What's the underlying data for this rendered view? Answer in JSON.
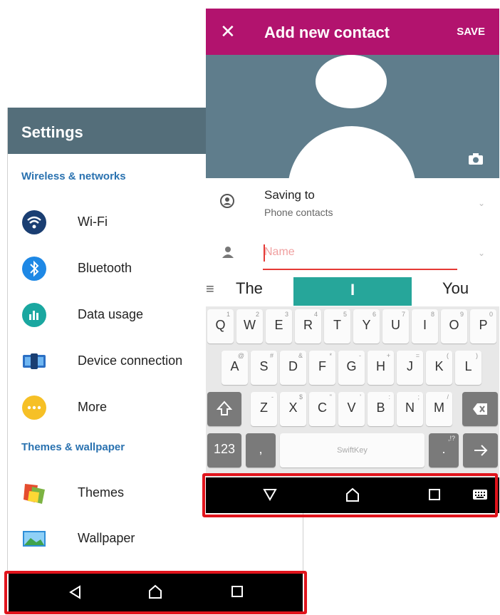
{
  "settings": {
    "title": "Settings",
    "sections": [
      {
        "label": "Wireless & networks"
      },
      {
        "label": "Themes & wallpaper"
      }
    ],
    "items": [
      {
        "label": "Wi-Fi",
        "icon": "wifi-icon",
        "color": "#1a3e72"
      },
      {
        "label": "Bluetooth",
        "icon": "bluetooth-icon",
        "color": "#1e88e5"
      },
      {
        "label": "Data usage",
        "icon": "data-usage-icon",
        "color": "#1aa7a0"
      },
      {
        "label": "Device connection",
        "icon": "device-connection-icon",
        "color": "#2b6fc4"
      },
      {
        "label": "More",
        "icon": "more-icon",
        "color": "#f6c026"
      },
      {
        "label": "Themes",
        "icon": "themes-icon",
        "color": "#e54d2e"
      },
      {
        "label": "Wallpaper",
        "icon": "wallpaper-icon",
        "color": "#2f8fd8"
      }
    ],
    "navbar": {
      "back": "back-icon",
      "home": "home-icon",
      "recents": "recents-icon"
    }
  },
  "contact": {
    "close_label": "✕",
    "title": "Add new contact",
    "save_label": "SAVE",
    "saving_to_label": "Saving to",
    "saving_to_value": "Phone contacts",
    "name_placeholder": "Name",
    "suggestions": [
      "The",
      "I",
      "You"
    ],
    "keyboard": {
      "row1": [
        {
          "c": "Q",
          "s": "1"
        },
        {
          "c": "W",
          "s": "2"
        },
        {
          "c": "E",
          "s": "3"
        },
        {
          "c": "R",
          "s": "4"
        },
        {
          "c": "T",
          "s": "5"
        },
        {
          "c": "Y",
          "s": "6"
        },
        {
          "c": "U",
          "s": "7"
        },
        {
          "c": "I",
          "s": "8"
        },
        {
          "c": "O",
          "s": "9"
        },
        {
          "c": "P",
          "s": "0"
        }
      ],
      "row2": [
        {
          "c": "A",
          "s": "@"
        },
        {
          "c": "S",
          "s": "#"
        },
        {
          "c": "D",
          "s": "&"
        },
        {
          "c": "F",
          "s": "*"
        },
        {
          "c": "G",
          "s": "-"
        },
        {
          "c": "H",
          "s": "+"
        },
        {
          "c": "J",
          "s": "="
        },
        {
          "c": "K",
          "s": "("
        },
        {
          "c": "L",
          "s": ")"
        }
      ],
      "row3": [
        {
          "c": "Z",
          "s": "-"
        },
        {
          "c": "X",
          "s": "$"
        },
        {
          "c": "C",
          "s": "\""
        },
        {
          "c": "V",
          "s": "'"
        },
        {
          "c": "B",
          "s": ":"
        },
        {
          "c": "N",
          "s": ";"
        },
        {
          "c": "M",
          "s": "/"
        }
      ],
      "numbers_label": "123",
      "comma_label": ",",
      "space_label": "SwiftKey",
      "period_label": ".",
      "period_sub": ",!?"
    },
    "navbar": {
      "back": "back-down-icon",
      "home": "home-icon",
      "recents": "recents-icon",
      "keyboard": "keyboard-icon"
    },
    "accent": "#b2136e"
  },
  "highlight_color": "#e0141c"
}
